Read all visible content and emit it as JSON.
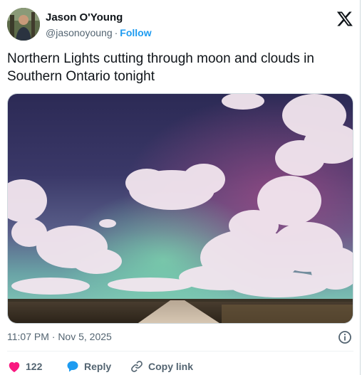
{
  "author": {
    "name": "Jason O'Young",
    "handle": "@jasonoyoung",
    "separator": "·",
    "follow_label": "Follow"
  },
  "tweet": {
    "text": "Northern Lights cutting through moon and clouds in Southern Ontario tonight",
    "timestamp": "11:07 PM · Nov 5, 2025"
  },
  "actions": {
    "like_count": "122",
    "reply_label": "Reply",
    "copy_label": "Copy link"
  },
  "colors": {
    "like": "#f91880",
    "reply": "#1d9bf0",
    "follow": "#1d9bf0",
    "muted": "#536471"
  },
  "icons": [
    "x-logo-icon",
    "info-icon",
    "heart-icon",
    "reply-bubble-icon",
    "link-icon"
  ]
}
